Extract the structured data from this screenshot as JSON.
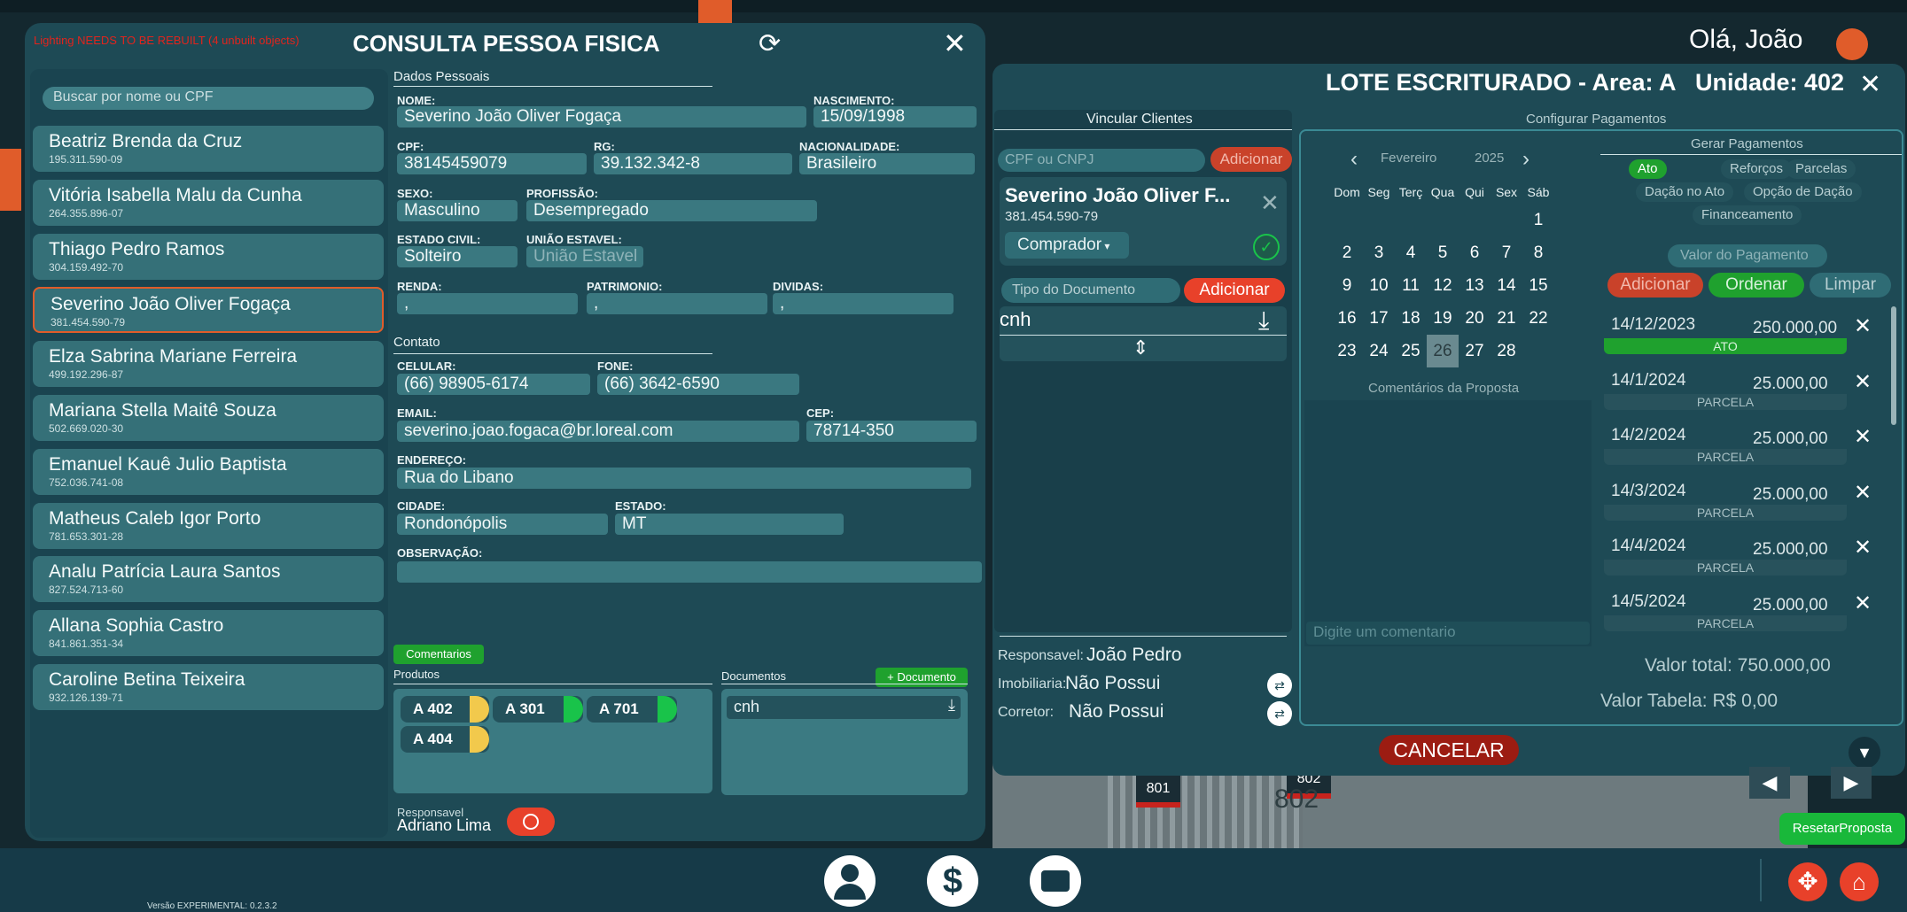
{
  "warning": "Lighting NEEDS TO BE REBUILT (4 unbuilt objects)",
  "greeting": "Olá, João",
  "version": "Versão EXPERIMENTAL: 0.2.3.2",
  "left": {
    "title": "CONSULTA PESSOA FISICA",
    "search_placeholder": "Buscar por nome ou CPF",
    "people": [
      {
        "name": "Beatriz Brenda da Cruz",
        "cpf": "195.311.590-09"
      },
      {
        "name": "Vitória Isabella Malu da Cunha",
        "cpf": "264.355.896-07"
      },
      {
        "name": "Thiago Pedro Ramos",
        "cpf": "304.159.492-70"
      },
      {
        "name": "Severino João Oliver Fogaça",
        "cpf": "381.454.590-79"
      },
      {
        "name": "Elza Sabrina Mariane Ferreira",
        "cpf": "499.192.296-87"
      },
      {
        "name": "Mariana Stella Maitê Souza",
        "cpf": "502.669.020-30"
      },
      {
        "name": "Emanuel Kauê Julio Baptista",
        "cpf": "752.036.741-08"
      },
      {
        "name": "Matheus Caleb Igor Porto",
        "cpf": "781.653.301-28"
      },
      {
        "name": "Analu Patrícia Laura Santos",
        "cpf": "827.524.713-60"
      },
      {
        "name": "Allana Sophia Castro",
        "cpf": "841.861.351-34"
      },
      {
        "name": "Caroline Betina Teixeira",
        "cpf": "932.126.139-71"
      }
    ],
    "dados_title": "Dados Pessoais",
    "labels": {
      "nome": "NOME:",
      "nascimento": "NASCIMENTO:",
      "cpf": "CPF:",
      "rg": "RG:",
      "nacionalidade": "NACIONALIDADE:",
      "sexo": "SEXO:",
      "profissao": "PROFISSÃO:",
      "estado_civil": "ESTADO CIVIL:",
      "uniao": "UNIÃO ESTAVEL:",
      "renda": "RENDA:",
      "patrimonio": "PATRIMONIO:",
      "dividas": "DIVIDAS:",
      "celular": "CELULAR:",
      "fone": "FONE:",
      "email": "EMAIL:",
      "cep": "CEP:",
      "endereco": "ENDEREÇO:",
      "cidade": "CIDADE:",
      "estado": "ESTADO:",
      "observacao": "OBSERVAÇÃO:"
    },
    "values": {
      "nome": "Severino João Oliver Fogaça",
      "nascimento": "15/09/1998",
      "cpf": "38145459079",
      "rg": "39.132.342-8",
      "nacionalidade": "Brasileiro",
      "sexo": "Masculino",
      "profissao": "Desempregado",
      "estado_civil": "Solteiro",
      "uniao": "União Estavel",
      "renda": ",",
      "patrimonio": ",",
      "dividas": ",",
      "celular": "(66) 98905-6174",
      "fone": "(66) 3642-6590",
      "email": "severino.joao.fogaca@br.loreal.com",
      "cep": "78714-350",
      "endereco": "Rua do Libano",
      "cidade": "Rondonópolis",
      "estado": "MT",
      "observacao": ""
    },
    "contato_title": "Contato",
    "comentarios_btn": "Comentarios",
    "produtos_title": "Produtos",
    "produtos": [
      "A 402",
      "A 301",
      "A 701",
      "A 404"
    ],
    "documentos_title": "Documentos",
    "add_doc_btn": "+ Documento",
    "doc_item": "cnh",
    "responsavel_label": "Responsavel",
    "responsavel_name": "Adriano Lima"
  },
  "right": {
    "title": "LOTE ESCRITURADO - Area: A   Unidade: 402",
    "vincular_title": "Vincular Clientes",
    "cpf_placeholder": "CPF ou CNPJ",
    "adicionar": "Adicionar",
    "client_name": "Severino João Oliver F...",
    "client_cpf": "381.454.590-79",
    "role": "Comprador",
    "tipo_doc_placeholder": "Tipo do Documento",
    "doc_value": "cnh",
    "responsavel_label": "Responsavel:",
    "responsavel": "João Pedro",
    "imobiliaria_label": "Imobiliaria:",
    "imobiliaria": "Não Possui",
    "corretor_label": "Corretor:",
    "corretor": "Não Possui",
    "config_title": "Configurar Pagamentos",
    "month": "Fevereiro",
    "year": "2025",
    "weekdays": [
      "Dom",
      "Seg",
      "Terç",
      "Qua",
      "Qui",
      "Sex",
      "Sáb"
    ],
    "weeks": [
      [
        "",
        "",
        "",
        "",
        "",
        "",
        "1"
      ],
      [
        "2",
        "3",
        "4",
        "5",
        "6",
        "7",
        "8"
      ],
      [
        "9",
        "10",
        "11",
        "12",
        "13",
        "14",
        "15"
      ],
      [
        "16",
        "17",
        "18",
        "19",
        "20",
        "21",
        "22"
      ],
      [
        "23",
        "24",
        "25",
        "26",
        "27",
        "28",
        ""
      ]
    ],
    "selected_day": "26",
    "comentarios_title": "Comentários da Proposta",
    "comment_placeholder": "Digite um comentario",
    "gerar_title": "Gerar Pagamentos",
    "tabs": [
      "Ato",
      "Reforços",
      "Parcelas",
      "Dação no Ato",
      "Opção de Dação",
      "Financeamento"
    ],
    "valor_placeholder": "Valor do Pagamento",
    "btn_adicionar": "Adicionar",
    "btn_ordenar": "Ordenar",
    "btn_limpar": "Limpar",
    "payments": [
      {
        "date": "14/12/2023",
        "value": "250.000,00",
        "type": "ATO"
      },
      {
        "date": "14/1/2024",
        "value": "25.000,00",
        "type": "PARCELA"
      },
      {
        "date": "14/2/2024",
        "value": "25.000,00",
        "type": "PARCELA"
      },
      {
        "date": "14/3/2024",
        "value": "25.000,00",
        "type": "PARCELA"
      },
      {
        "date": "14/4/2024",
        "value": "25.000,00",
        "type": "PARCELA"
      },
      {
        "date": "14/5/2024",
        "value": "25.000,00",
        "type": "PARCELA"
      }
    ],
    "valor_total": "Valor total: 750.000,00",
    "valor_tabela": "Valor Tabela: R$ 0,00",
    "cancelar": "CANCELAR"
  },
  "reset_btn": "ResetarProposta",
  "map_labels": [
    "801",
    "802",
    "802"
  ]
}
